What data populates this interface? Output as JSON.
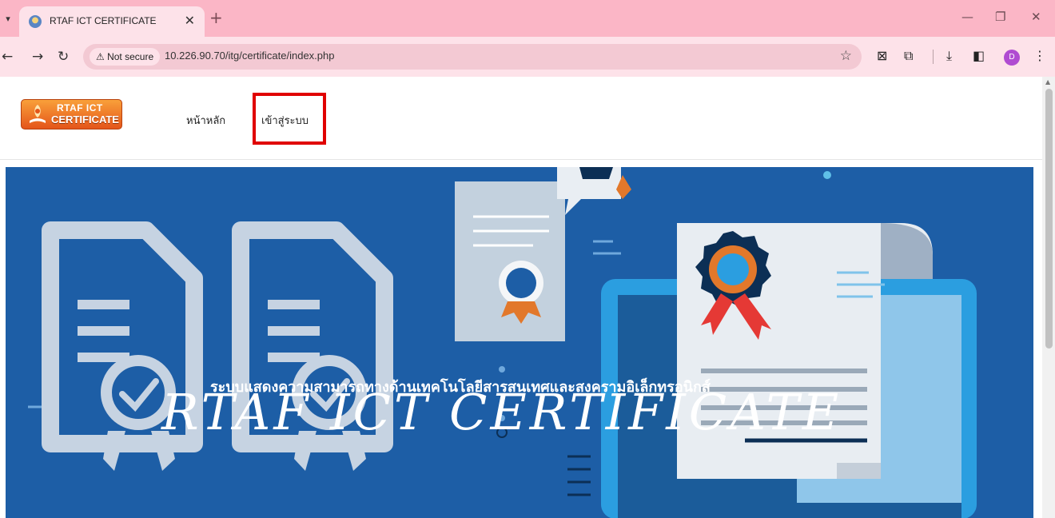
{
  "browser": {
    "tab_title": "RTAF ICT CERTIFICATE",
    "security_label": "Not secure",
    "url": "10.226.90.70/itg/certificate/index.php",
    "profile_initial": "D"
  },
  "site": {
    "nav": {
      "home": "หน้าหลัก",
      "login": "เข้าสู่ระบบ"
    },
    "hero": {
      "title": "RTAF ICT CERTIFICATE",
      "subtitle": "ระบบแสดงความสามารถทางด้านเทคโนโลยีสารสนเทศและสงครามอิเล็กทรอนิกส์"
    }
  },
  "colors": {
    "hero_bg": "#1d5ea6",
    "highlight_box": "#e00000",
    "tab_strip": "#fbb6c6"
  }
}
